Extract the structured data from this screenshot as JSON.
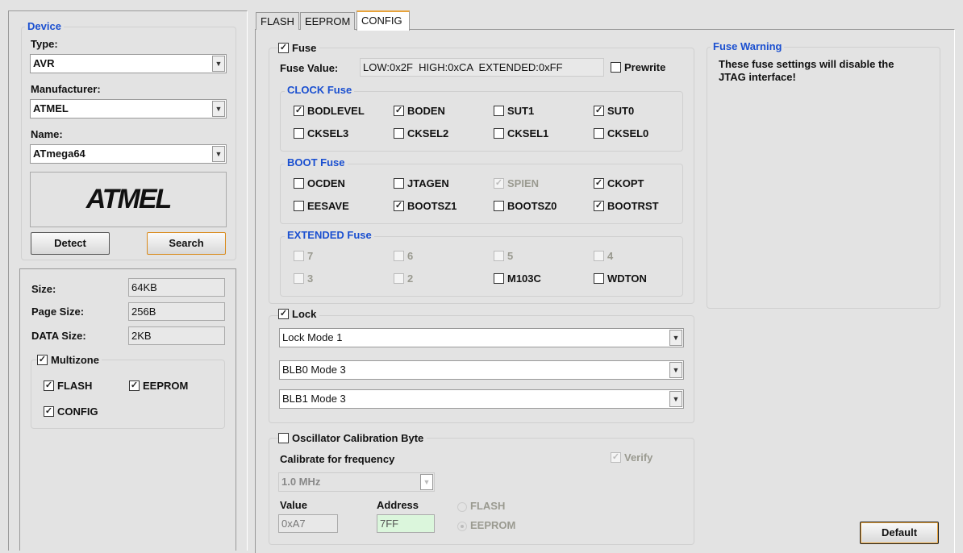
{
  "device": {
    "title": "Device",
    "type_label": "Type:",
    "type_value": "AVR",
    "manufacturer_label": "Manufacturer:",
    "manufacturer_value": "ATMEL",
    "name_label": "Name:",
    "name_value": "ATmega64",
    "logo_text": "ATMEL",
    "detect": "Detect",
    "search": "Search"
  },
  "info": {
    "size_label": "Size:",
    "size": "64KB",
    "page_label": "Page Size:",
    "page": "256B",
    "data_label": "DATA Size:",
    "data": "2KB",
    "multizone": "Multizone",
    "flash": "FLASH",
    "eeprom": "EEPROM",
    "config": "CONFIG"
  },
  "tabs": [
    "FLASH",
    "EEPROM",
    "CONFIG"
  ],
  "fuse": {
    "label": "Fuse",
    "value_label": "Fuse Value:",
    "value": "LOW:0x2F  HIGH:0xCA  EXTENDED:0xFF",
    "prewrite": "Prewrite",
    "groups": [
      {
        "title": "CLOCK Fuse",
        "items": [
          {
            "l": "BODLEVEL",
            "c": true
          },
          {
            "l": "BODEN",
            "c": true
          },
          {
            "l": "SUT1",
            "c": false
          },
          {
            "l": "SUT0",
            "c": true
          },
          {
            "l": "CKSEL3",
            "c": false
          },
          {
            "l": "CKSEL2",
            "c": false
          },
          {
            "l": "CKSEL1",
            "c": false
          },
          {
            "l": "CKSEL0",
            "c": false
          }
        ]
      },
      {
        "title": "BOOT Fuse",
        "items": [
          {
            "l": "OCDEN",
            "c": false
          },
          {
            "l": "JTAGEN",
            "c": false
          },
          {
            "l": "SPIEN",
            "c": true,
            "d": true
          },
          {
            "l": "CKOPT",
            "c": true
          },
          {
            "l": "EESAVE",
            "c": false
          },
          {
            "l": "BOOTSZ1",
            "c": true
          },
          {
            "l": "BOOTSZ0",
            "c": false
          },
          {
            "l": "BOOTRST",
            "c": true
          }
        ]
      },
      {
        "title": "EXTENDED Fuse",
        "items": [
          {
            "l": "7",
            "c": false,
            "d": true
          },
          {
            "l": "6",
            "c": false,
            "d": true
          },
          {
            "l": "5",
            "c": false,
            "d": true
          },
          {
            "l": "4",
            "c": false,
            "d": true
          },
          {
            "l": "3",
            "c": false,
            "d": true
          },
          {
            "l": "2",
            "c": false,
            "d": true
          },
          {
            "l": "M103C",
            "c": false
          },
          {
            "l": "WDTON",
            "c": false
          }
        ]
      }
    ]
  },
  "lock": {
    "label": "Lock",
    "mode": "Lock Mode 1",
    "blb0": "BLB0 Mode 3",
    "blb1": "BLB1 Mode 3"
  },
  "osc": {
    "label": "Oscillator Calibration Byte",
    "freq_label": "Calibrate for frequency",
    "freq": "1.0 MHz",
    "verify": "Verify",
    "value_label": "Value",
    "value": "0xA7",
    "address_label": "Address",
    "address": "7FF",
    "flash": "FLASH",
    "eeprom": "EEPROM"
  },
  "warning": {
    "title": "Fuse Warning",
    "text": "These fuse settings will disable the JTAG interface!"
  },
  "default_button": "Default"
}
